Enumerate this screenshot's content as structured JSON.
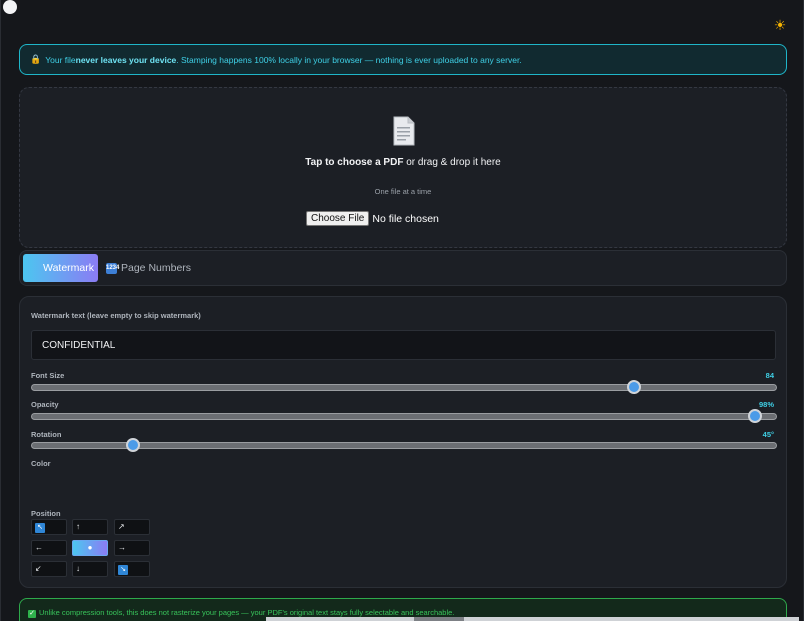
{
  "theme_toggle": {
    "icon": "sun-icon",
    "glyph": "☀"
  },
  "privacy_banner": {
    "lock_icon": "🔒",
    "prefix": "Your file ",
    "bold": "never leaves your device",
    "suffix": ". Stamping happens 100% locally in your browser — nothing is ever uploaded to any server."
  },
  "dropzone": {
    "title_bold": "Tap to choose a PDF",
    "title_rest": " or drag & drop it here",
    "subtitle": "One file at a time",
    "choose_button": "Choose File",
    "no_file": "No file chosen"
  },
  "tabs": [
    {
      "label": "Watermark",
      "active": true
    },
    {
      "label": "Page Numbers",
      "icon": "1234",
      "active": false
    }
  ],
  "watermark": {
    "text_label": "Watermark text (leave empty to skip watermark)",
    "text_value": "CONFIDENTIAL",
    "font_size": {
      "label": "Font Size",
      "value": "84",
      "fraction": 0.814
    },
    "opacity": {
      "label": "Opacity",
      "value": "98%",
      "fraction": 0.98
    },
    "rotation": {
      "label": "Rotation",
      "value": "45°",
      "fraction": 0.13
    },
    "color_label": "Color",
    "position_label": "Position",
    "positions": [
      {
        "glyph": "↖",
        "active": false
      },
      {
        "glyph": "↑",
        "active": false
      },
      {
        "glyph": "↗",
        "active": false
      },
      {
        "glyph": "←",
        "active": false
      },
      {
        "glyph": "●",
        "active": true
      },
      {
        "glyph": "→",
        "active": false
      },
      {
        "glyph": "↙",
        "active": false
      },
      {
        "glyph": "↓",
        "active": false
      },
      {
        "glyph": "↘",
        "active": false
      }
    ]
  },
  "info_banner": {
    "text": "Unlike compression tools, this does not rasterize your pages — your PDF's original text stays fully selectable and searchable."
  },
  "colors": {
    "accent_cyan": "#3fd0e6",
    "accent_gradient_start": "#4cc6f0",
    "accent_gradient_end": "#8b7cf4",
    "success_green": "#38c45a",
    "background": "#15171b"
  }
}
